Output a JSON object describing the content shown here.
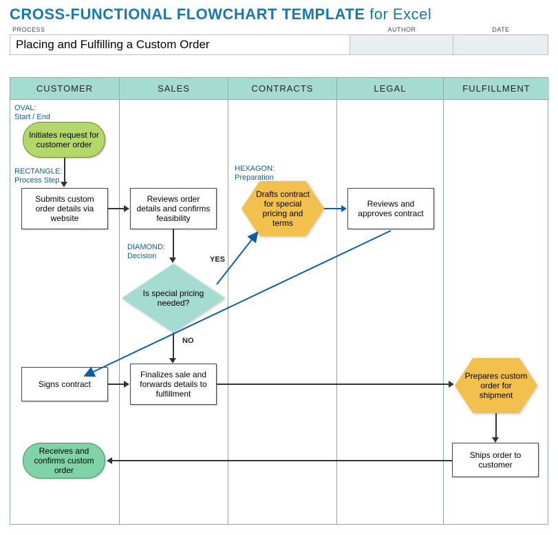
{
  "title_strong": "CROSS-FUNCTIONAL FLOWCHART TEMPLATE",
  "title_light": " for Excel",
  "meta": {
    "process_label": "PROCESS",
    "author_label": "AUTHOR",
    "date_label": "DATE",
    "process_value": "Placing and Fulfilling a Custom Order",
    "author_value": "",
    "date_value": ""
  },
  "lanes": [
    "CUSTOMER",
    "SALES",
    "CONTRACTS",
    "LEGAL",
    "FULFILLMENT"
  ],
  "hints": {
    "oval": "OVAL:\nStart / End",
    "rect": "RECTANGLE:\nProcess Step",
    "hex": "HEXAGON:\nPreparation",
    "diamond": "DIAMOND:\nDecision"
  },
  "nodes": {
    "n1": "Initiates request for customer order",
    "n2": "Submits custom order details via website",
    "n3": "Reviews order details and confirms feasibility",
    "n4": "Is special pricing needed?",
    "n5": "Drafts contract for special pricing and terms",
    "n6": "Reviews and approves contract",
    "n7": "Signs contract",
    "n8": "Finalizes sale and forwards details to fulfillment",
    "n9": "Prepares custom order for shipment",
    "n10": "Ships order to customer",
    "n11": "Receives and confirms custom order"
  },
  "labels": {
    "yes": "YES",
    "no": "NO"
  }
}
